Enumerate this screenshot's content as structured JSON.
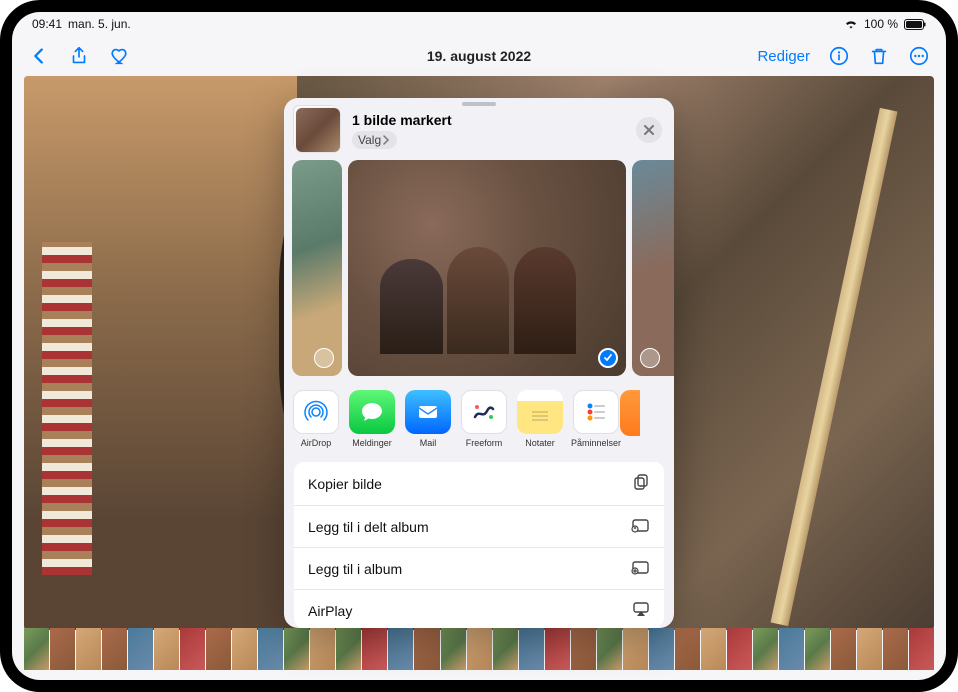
{
  "status": {
    "time": "09:41",
    "date": "man. 5. jun.",
    "battery": "100 %"
  },
  "toolbar": {
    "title": "19. august 2022",
    "edit": "Rediger"
  },
  "share": {
    "title": "1 bilde markert",
    "options_label": "Valg",
    "apps": [
      {
        "label": "AirDrop"
      },
      {
        "label": "Meldinger"
      },
      {
        "label": "Mail"
      },
      {
        "label": "Freeform"
      },
      {
        "label": "Notater"
      },
      {
        "label": "Påminnelser"
      },
      {
        "label": ""
      }
    ],
    "actions": [
      {
        "label": "Kopier bilde",
        "icon": "copy"
      },
      {
        "label": "Legg til i delt album",
        "icon": "shared-album"
      },
      {
        "label": "Legg til i album",
        "icon": "album"
      },
      {
        "label": "AirPlay",
        "icon": "airplay"
      }
    ]
  }
}
